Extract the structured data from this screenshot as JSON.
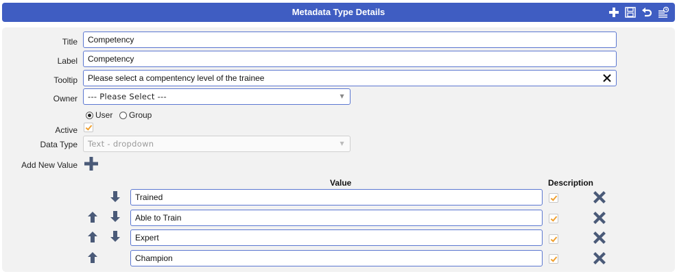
{
  "header": {
    "title": "Metadata Type Details",
    "icons": [
      "plus-icon",
      "save-icon",
      "undo-icon",
      "history-icon"
    ]
  },
  "form": {
    "title_label": "Title",
    "title_value": "Competency",
    "label_label": "Label",
    "label_value": "Competency",
    "tooltip_label": "Tooltip",
    "tooltip_value": "Please select a compentency level of the trainee",
    "owner_label": "Owner",
    "owner_value": "--- Please Select ---",
    "owner_type_options": [
      {
        "label": "User",
        "selected": true
      },
      {
        "label": "Group",
        "selected": false
      }
    ],
    "active_label": "Active",
    "active_checked": true,
    "data_type_label": "Data Type",
    "data_type_value": "Text - dropdown",
    "add_new_value_label": "Add New Value"
  },
  "values_table": {
    "columns": [
      "Value",
      "Description"
    ],
    "rows": [
      {
        "value": "Trained",
        "description": true,
        "can_move_up": false,
        "can_move_down": true
      },
      {
        "value": "Able to Train",
        "description": true,
        "can_move_up": true,
        "can_move_down": true
      },
      {
        "value": "Expert",
        "description": true,
        "can_move_up": true,
        "can_move_down": true
      },
      {
        "value": "Champion",
        "description": true,
        "can_move_up": true,
        "can_move_down": false
      }
    ]
  },
  "colors": {
    "header_bg": "#3f5dc2",
    "field_border": "#5a76d0",
    "icon": "#4a5a78",
    "check": "#f0a030"
  }
}
